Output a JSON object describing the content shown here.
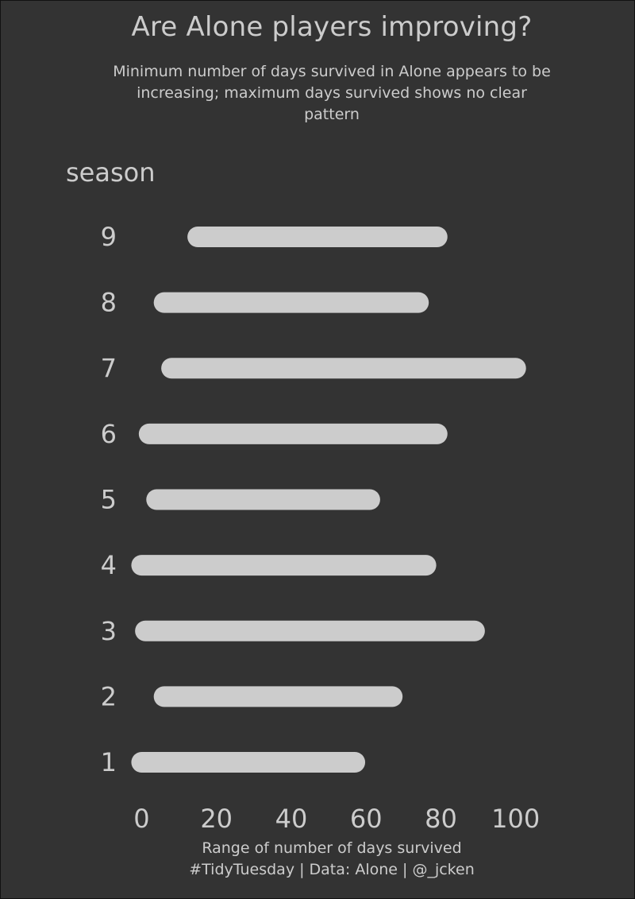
{
  "chart_data": {
    "type": "bar",
    "orientation": "horizontal-range",
    "title": "Are Alone players improving?",
    "subtitle": "Minimum number of days survived in Alone appears to be increasing; maximum days survived shows no clear pattern",
    "ylabel": "season",
    "xlabel": "Range of number of days survived",
    "caption": "#TidyTuesday | Data: Alone | @_jcken",
    "categories": [
      "1",
      "2",
      "3",
      "4",
      "5",
      "6",
      "7",
      "8",
      "9"
    ],
    "min_days": [
      0,
      6,
      1,
      0,
      4,
      2,
      8,
      6,
      15
    ],
    "max_days": [
      57,
      67,
      89,
      76,
      61,
      79,
      100,
      74,
      79
    ],
    "xlim": [
      -2,
      106
    ],
    "xticks": [
      0,
      20,
      40,
      60,
      80,
      100
    ],
    "grid": false,
    "colors": {
      "background": "#333333",
      "bar": "#cccccc",
      "text": "#cccccc"
    }
  }
}
